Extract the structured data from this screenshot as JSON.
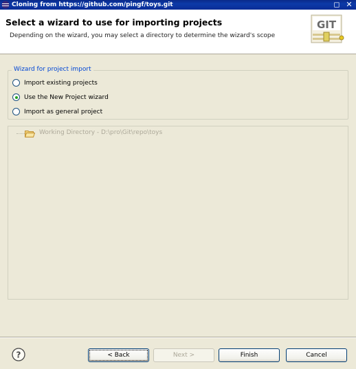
{
  "window": {
    "title": "Cloning from https://github.com/pingf/toys.git",
    "maximize_glyph": "◻",
    "close_glyph": "✕"
  },
  "header": {
    "title": "Select a wizard to use for importing projects",
    "description": "Depending on the wizard, you may select a directory to determine the wizard's scope",
    "banner_text": "GIT"
  },
  "wizard_group": {
    "label": "Wizard for project import",
    "options": [
      {
        "label": "Import existing projects",
        "checked": false
      },
      {
        "label": "Use the New Project wizard",
        "checked": true
      },
      {
        "label": "Import as general project",
        "checked": false
      }
    ]
  },
  "tree": {
    "item_label": "Working Directory - D:\\pro\\Git\\repo\\toys",
    "item_icon": "folder-open-icon"
  },
  "footer": {
    "help_glyph": "?",
    "back_label": "< Back",
    "next_label": "Next >",
    "finish_label": "Finish",
    "cancel_label": "Cancel"
  },
  "colors": {
    "title_bar": "#0c3aa8",
    "group_label": "#0046d5",
    "disabled_text": "#aca899",
    "dialog_bg": "#ece9d8"
  }
}
